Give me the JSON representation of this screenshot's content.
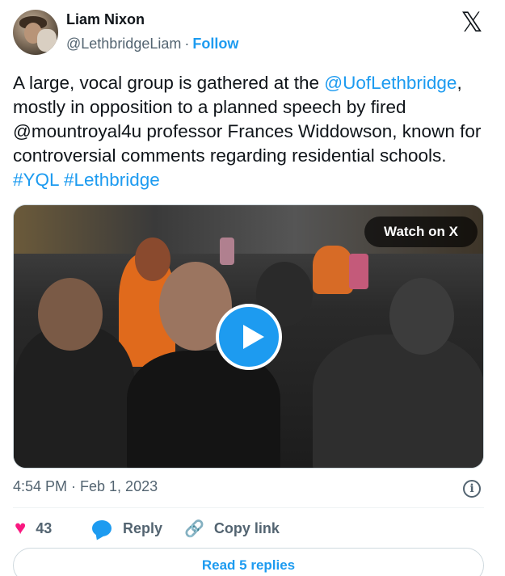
{
  "author": {
    "name": "Liam Nixon",
    "handle": "@LethbridgeLiam",
    "separator": "·",
    "follow_label": "Follow"
  },
  "platform": {
    "logo_icon": "x-logo-icon",
    "logo_glyph": "𝕏"
  },
  "tweet": {
    "text_1": "A large, vocal group is gathered at the ",
    "mention_1": "@UofLethbridge",
    "text_2": ", mostly in opposition to a planned speech by fired @mountroyal4u professor Frances Widdowson, known for controversial comments regarding residential schools. ",
    "hashtag_1": "#YQL",
    "hashtag_2": "#Lethbridge"
  },
  "media": {
    "watch_label": "Watch on X",
    "play_icon": "play-icon"
  },
  "timestamp": "4:54 PM · Feb 1, 2023",
  "info_icon": "info-icon",
  "actions": {
    "likes_count": "43",
    "reply_label": "Reply",
    "copy_link_label": "Copy link"
  },
  "read_replies_label": "Read 5 replies",
  "colors": {
    "accent": "#1d9bf0",
    "like": "#f91880",
    "secondary_text": "#536471",
    "primary_text": "#0f1419"
  }
}
